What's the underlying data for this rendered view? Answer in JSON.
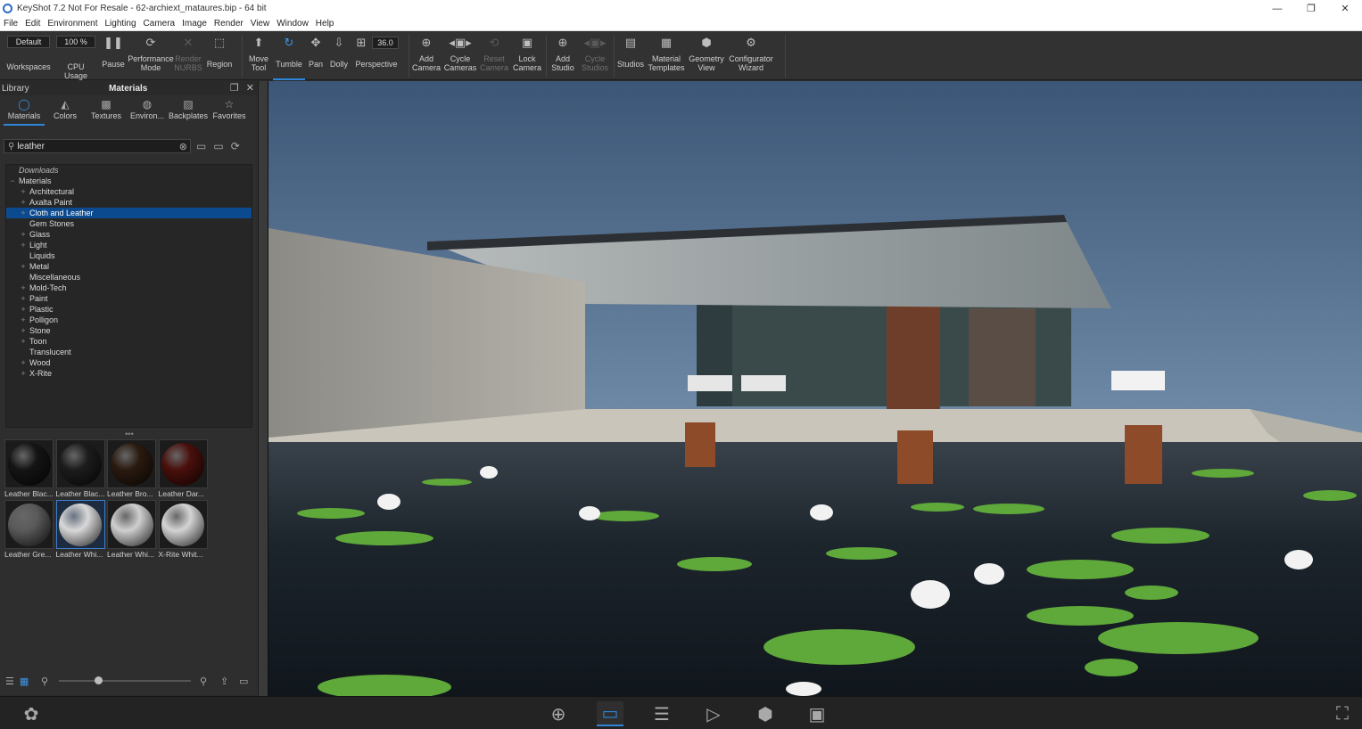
{
  "window": {
    "title": "KeyShot 7.2 Not For Resale - 62-archiext_mataures.bip - 64 bit",
    "controls": [
      "—",
      "❐",
      "✕"
    ]
  },
  "menu": [
    "File",
    "Edit",
    "Environment",
    "Lighting",
    "Camera",
    "Image",
    "Render",
    "View",
    "Window",
    "Help"
  ],
  "toolbar": {
    "workspace_value": "Default",
    "cpu_value": "100 %",
    "fov_value": "36.0",
    "buttons": {
      "workspaces": "Workspaces",
      "cpu_usage": "CPU Usage",
      "pause": "Pause",
      "performance_mode": "Performance Mode",
      "render_nurbs": "Render NURBS",
      "region": "Region",
      "move_tool": "Move Tool",
      "tumble": "Tumble",
      "pan": "Pan",
      "dolly": "Dolly",
      "perspective": "Perspective",
      "add_camera": "Add Camera",
      "cycle_cameras": "Cycle Cameras",
      "reset_camera": "Reset Camera",
      "lock_camera": "Lock Camera",
      "add_studio": "Add Studio",
      "cycle_studios": "Cycle Studios",
      "studios": "Studios",
      "material_templates": "Material Templates",
      "geometry_view": "Geometry View",
      "configurator_wizard": "Configurator Wizard"
    }
  },
  "library": {
    "title": "Library",
    "section": "Materials",
    "tabs": [
      "Materials",
      "Colors",
      "Textures",
      "Environ...",
      "Backplates",
      "Favorites"
    ],
    "search_value": "leather",
    "tree": [
      {
        "label": "Downloads",
        "level": 0,
        "italic": true,
        "exp": ""
      },
      {
        "label": "Materials",
        "level": 0,
        "exp": "−"
      },
      {
        "label": "Architectural",
        "level": 1,
        "exp": "+"
      },
      {
        "label": "Axalta Paint",
        "level": 1,
        "exp": "+"
      },
      {
        "label": "Cloth and Leather",
        "level": 1,
        "exp": "+",
        "selected": true
      },
      {
        "label": "Gem Stones",
        "level": 1,
        "exp": ""
      },
      {
        "label": "Glass",
        "level": 1,
        "exp": "+"
      },
      {
        "label": "Light",
        "level": 1,
        "exp": "+"
      },
      {
        "label": "Liquids",
        "level": 1,
        "exp": ""
      },
      {
        "label": "Metal",
        "level": 1,
        "exp": "+"
      },
      {
        "label": "Miscellaneous",
        "level": 1,
        "exp": ""
      },
      {
        "label": "Mold-Tech",
        "level": 1,
        "exp": "+"
      },
      {
        "label": "Paint",
        "level": 1,
        "exp": "+"
      },
      {
        "label": "Plastic",
        "level": 1,
        "exp": "+"
      },
      {
        "label": "Polligon",
        "level": 1,
        "exp": "+"
      },
      {
        "label": "Stone",
        "level": 1,
        "exp": "+"
      },
      {
        "label": "Toon",
        "level": 1,
        "exp": "+"
      },
      {
        "label": "Translucent",
        "level": 1,
        "exp": ""
      },
      {
        "label": "Wood",
        "level": 1,
        "exp": "+"
      },
      {
        "label": "X-Rite",
        "level": 1,
        "exp": "+"
      }
    ],
    "thumbnails": [
      {
        "label": "Leather Blac...",
        "color": "#141414"
      },
      {
        "label": "Leather Blac...",
        "color": "#1c1c1c"
      },
      {
        "label": "Leather Bro...",
        "color": "#2a1a10"
      },
      {
        "label": "Leather Dar...",
        "color": "#4a0f0c"
      },
      {
        "label": "Leather Gre...",
        "color": "#5a5a5a"
      },
      {
        "label": "Leather Whi...",
        "color": "#d8d8d8",
        "selected": true
      },
      {
        "label": "Leather Whi...",
        "color": "#cfcfcf"
      },
      {
        "label": "X-Rite Whit...",
        "color": "#d4d4d4"
      }
    ],
    "thumb_size": 0.3
  },
  "bottombar": {
    "icons": [
      "cloud-icon",
      "import-icon",
      "library-icon",
      "project-icon",
      "animation-icon",
      "keyshotxr-icon",
      "render-icon",
      "screenshot-icon"
    ]
  }
}
